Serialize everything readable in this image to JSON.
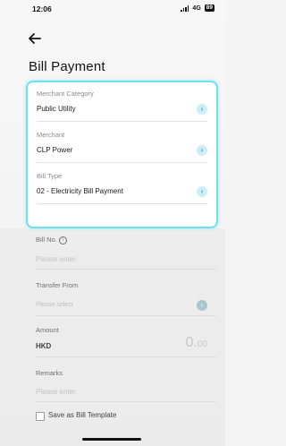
{
  "status": {
    "time": "12:06",
    "network": "4G",
    "battery": "89"
  },
  "header": {
    "title": "Bill Payment"
  },
  "card": {
    "merchant_category": {
      "label": "Merchant Category",
      "value": "Public Utility"
    },
    "merchant": {
      "label": "Merchant",
      "value": "CLP Power"
    },
    "bill_type": {
      "label": "Bill Type",
      "value": "02 - Electricity Bill Payment"
    }
  },
  "form": {
    "bill_no": {
      "label": "Bill No.",
      "placeholder": "Please enter"
    },
    "transfer_from": {
      "label": "Transfer From",
      "placeholder": "Please select"
    },
    "amount": {
      "label": "Amount",
      "currency": "HKD",
      "value_main": "0.",
      "value_dec": "00"
    },
    "remarks": {
      "label": "Remarks",
      "placeholder": "Please enter"
    },
    "template": {
      "label": "Save as Bill Template"
    }
  },
  "colors": {
    "accent": "#6ee0f2",
    "chevron": "#2aa3d6"
  }
}
